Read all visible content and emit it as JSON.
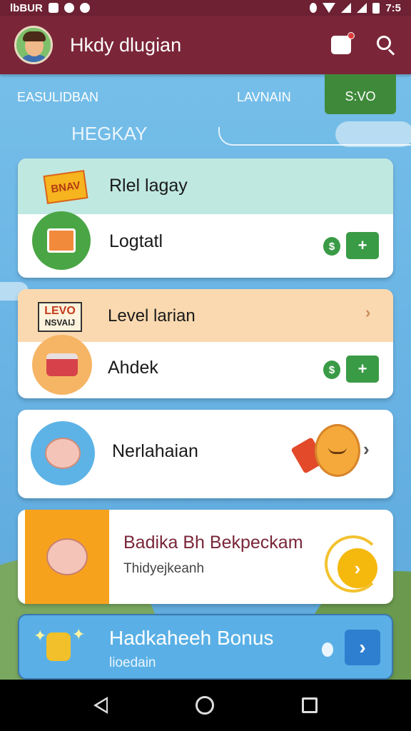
{
  "status_bar": {
    "left_text": "lbBUR",
    "time": "7:5"
  },
  "app_bar": {
    "title": "Hkdy dlugian"
  },
  "tabs": [
    {
      "label": "EASULIDBAN"
    },
    {
      "label": "LAVNAIN"
    },
    {
      "label": "S:VO",
      "active": true
    }
  ],
  "section": {
    "heading": "HEGKAY"
  },
  "cards": [
    {
      "badge_text": "BNAV",
      "header_title": "Rlel lagay",
      "title": "Logtatl",
      "coin_symbol": "$",
      "action_symbol": "+"
    },
    {
      "badge_text_line1": "LEVO",
      "badge_text_line2": "NSVAIJ",
      "header_title": "Level larian",
      "title": "Ahdek",
      "coin_symbol": "$",
      "action_symbol": "+",
      "chevron": "›"
    },
    {
      "title": "Nerlahaian",
      "chevron": "›"
    },
    {
      "title": "Badika Bh Bekpeckam",
      "subtitle": "Thidyejkeanh",
      "chevron": "›"
    },
    {
      "title": "Hadkaheeh Bonus",
      "subtitle": "lioedain",
      "chevron": "›"
    }
  ],
  "colors": {
    "app_bar": "#7a2638",
    "status_bar": "#6d2133",
    "active_tab": "#3f8a3a",
    "green_action": "#3a9b46",
    "card1_band": "#bfe8e0",
    "card2_band": "#fbd9b0",
    "bonus_bg": "#5ab0e6",
    "card4_title": "#7a2638"
  },
  "icons": {
    "notification": "notification-icon",
    "search": "search-icon",
    "back": "back-icon",
    "home": "home-icon",
    "recent": "recent-apps-icon"
  }
}
